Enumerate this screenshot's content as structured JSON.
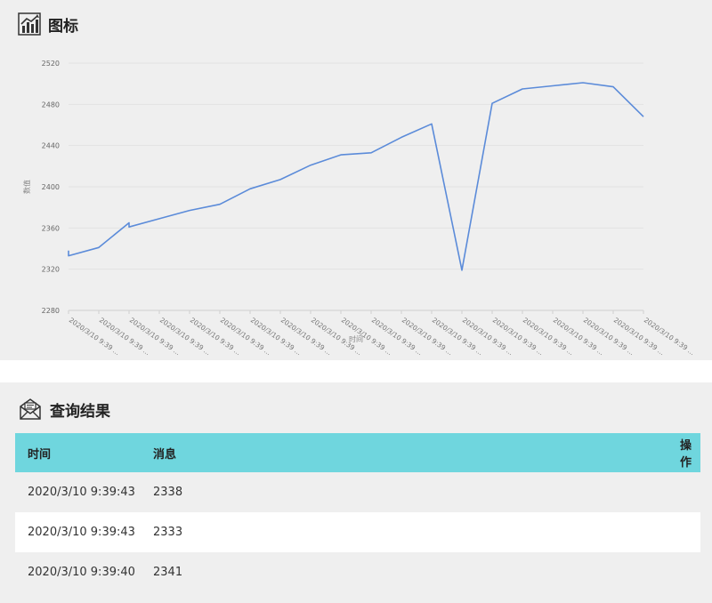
{
  "chart_section": {
    "title": "图标",
    "icon": "chart-bar-trend-icon"
  },
  "results_section": {
    "title": "查询结果",
    "icon": "mail-open-icon"
  },
  "table": {
    "headers": {
      "time": "时间",
      "message": "消息",
      "action": "操作"
    },
    "rows": [
      {
        "time": "2020/3/10 9:39:43",
        "message": "2338"
      },
      {
        "time": "2020/3/10 9:39:43",
        "message": "2333"
      },
      {
        "time": "2020/3/10 9:39:40",
        "message": "2341"
      }
    ]
  },
  "colors": {
    "line": "#5b8bd9",
    "table_header": "#6fd6de",
    "panel_bg": "#efefef"
  },
  "chart_data": {
    "type": "line",
    "ylabel": "数值",
    "xlabel": "时间",
    "ylim": [
      2280,
      2520
    ],
    "yticks": [
      2280,
      2320,
      2360,
      2400,
      2440,
      2480,
      2520
    ],
    "xtick_labels": [
      "2020/3/10 9:39 ...",
      "2020/3/10 9:39 ...",
      "2020/3/10 9:39 ...",
      "2020/3/10 9:39 ...",
      "2020/3/10 9:39 ...",
      "2020/3/10 9:39 ...",
      "2020/3/10 9:39 ...",
      "2020/3/10 9:39 ...",
      "2020/3/10 9:39 ...",
      "2020/3/10 9:39 ...",
      "2020/3/10 9:39 ...",
      "2020/3/10 9:39 ...",
      "2020/3/10 9:39 ...",
      "2020/3/10 9:39 ...",
      "2020/3/10 9:39 ...",
      "2020/3/10 9:39 ...",
      "2020/3/10 9:39 ...",
      "2020/3/10 9:39 ...",
      "2020/3/10 9:39 ...",
      "2020/3/10 9:39 ..."
    ],
    "grid": true,
    "series": [
      {
        "points": [
          [
            0,
            2338
          ],
          [
            0,
            2333
          ],
          [
            1,
            2341
          ],
          [
            2,
            2365
          ],
          [
            2,
            2361
          ],
          [
            3,
            2369
          ],
          [
            4,
            2377
          ],
          [
            5,
            2383
          ],
          [
            6,
            2398
          ],
          [
            7,
            2407
          ],
          [
            8,
            2421
          ],
          [
            9,
            2431
          ],
          [
            10,
            2433
          ],
          [
            11,
            2448
          ],
          [
            12,
            2461
          ],
          [
            13,
            2319
          ],
          [
            14,
            2481
          ],
          [
            15,
            2495
          ],
          [
            16,
            2498
          ],
          [
            17,
            2501
          ],
          [
            18,
            2497
          ],
          [
            19,
            2468
          ]
        ]
      }
    ]
  }
}
